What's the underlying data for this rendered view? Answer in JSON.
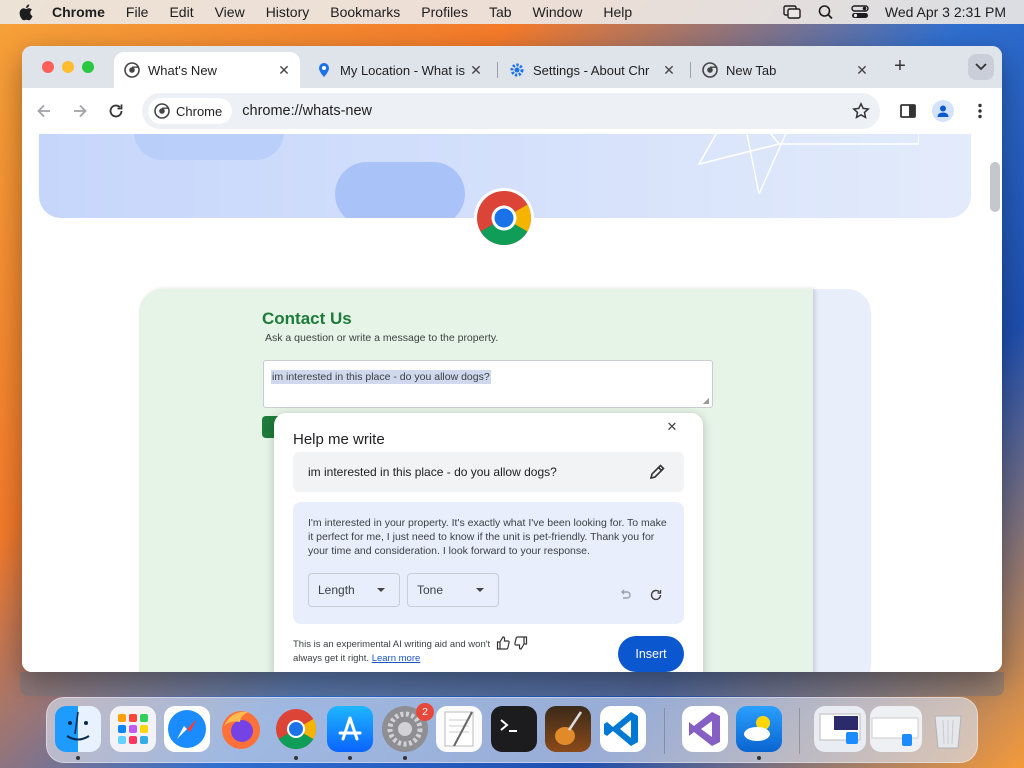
{
  "menubar": {
    "app_name": "Chrome",
    "items": [
      "File",
      "Edit",
      "View",
      "History",
      "Bookmarks",
      "Profiles",
      "Tab",
      "Window",
      "Help"
    ],
    "clock": "Wed Apr 3  2:31 PM"
  },
  "tabs": [
    {
      "title": "What's New",
      "active": true
    },
    {
      "title": "My Location - What is",
      "active": false
    },
    {
      "title": "Settings - About Chr",
      "active": false
    },
    {
      "title": "New Tab",
      "active": false
    }
  ],
  "omnibox": {
    "chip_label": "Chrome",
    "url": "chrome://whats-new"
  },
  "contact": {
    "title": "Contact Us",
    "subtitle": "Ask a question or write a message to the property.",
    "message": "im interested in this place - do you allow dogs?"
  },
  "help_me_write": {
    "title": "Help me write",
    "input": "im interested in this place - do you allow dogs?",
    "result": "I'm interested in your property. It's exactly what I've been looking for. To make it perfect for me, I just need to know if the unit is pet-friendly. Thank you for your time and consideration. I look forward to your response.",
    "length_label": "Length",
    "tone_label": "Tone",
    "disclaimer": "This is an experimental AI writing aid and won't always get it right.",
    "learn_more": "Learn more",
    "insert_label": "Insert"
  },
  "dock": {
    "settings_badge": "2"
  },
  "colors": {
    "accent_blue": "#0b57d0",
    "contact_green": "#1e7b3a"
  }
}
